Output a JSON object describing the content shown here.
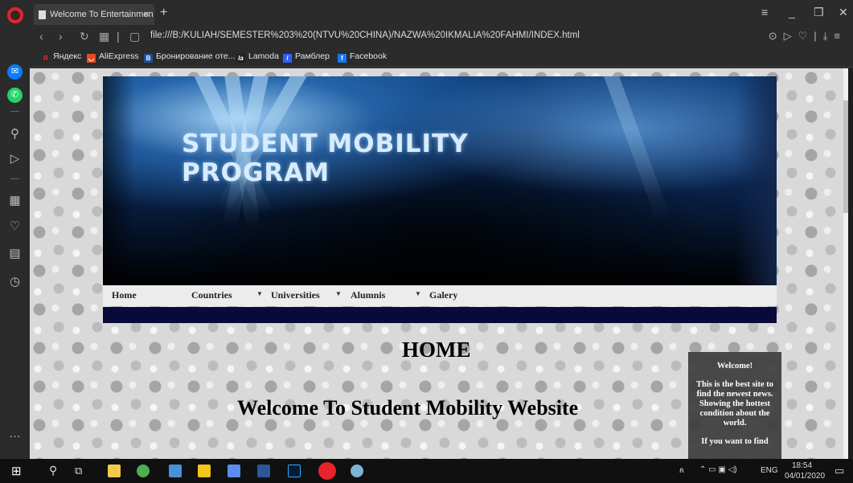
{
  "browser": {
    "tab_title": "Welcome To Entertainmen",
    "tab_close": "×",
    "new_tab": "+",
    "url": "file:///B:/KULIAH/SEMESTER%203%20(NTVU%20CHINA)/NAZWA%20IKMALIA%20FAHMI/INDEX.html"
  },
  "bookmarks": [
    {
      "label": "Яндекс",
      "icon": "yandex-icon",
      "color": "#e62e2e"
    },
    {
      "label": "AliExpress",
      "icon": "aliexpress-icon",
      "color": "#e64a1e"
    },
    {
      "label": "Бронирование оте...",
      "icon": "booking-icon",
      "color": "#1f4f9a"
    },
    {
      "label": "Lamoda",
      "icon": "lamoda-icon",
      "color": "#222222"
    },
    {
      "label": "Рамблер",
      "icon": "rambler-icon",
      "color": "#315efb"
    },
    {
      "label": "Facebook",
      "icon": "facebook-icon",
      "color": "#1877f2"
    }
  ],
  "site": {
    "banner_title_line1": "STUDENT MOBILITY",
    "banner_title_line2": "PROGRAM",
    "nav": {
      "home": "Home",
      "countries": "Countries",
      "universities": "Universities",
      "alumnis": "Alumnis",
      "galery": "Galery",
      "caret": "▼"
    },
    "heading": "HOME",
    "welcome": "Welcome To Student Mobility Website",
    "sidebox": {
      "title": "Welcome!",
      "body": "This is the best site to find the newest news. Showing the hottest condition about the world.",
      "more": "If you want to find"
    }
  },
  "taskbar": {
    "lang": "ENG",
    "time": "18:54",
    "date": "04/01/2020"
  },
  "colors": {
    "nav_strip": "#0a0a3a",
    "opera_red": "#e6232b"
  }
}
